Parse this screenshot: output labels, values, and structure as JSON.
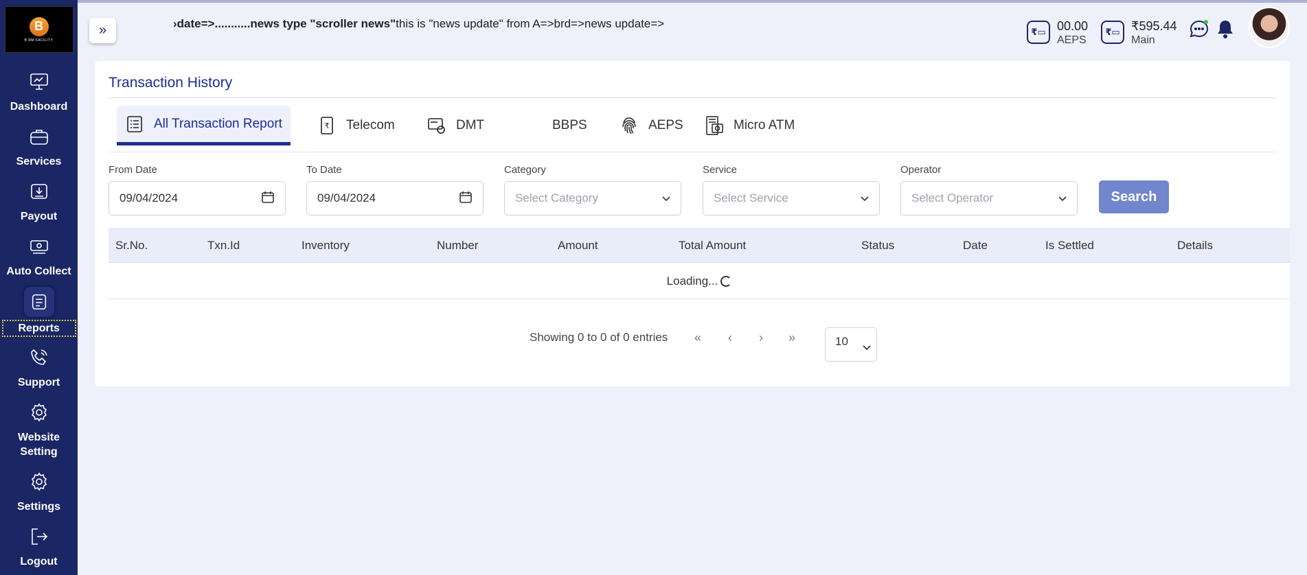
{
  "brand": {
    "logo_text": "B RM FACILITY"
  },
  "sidebar": {
    "items": [
      {
        "label": "Dashboard",
        "icon": "dashboard-icon"
      },
      {
        "label": "Services",
        "icon": "briefcase-icon"
      },
      {
        "label": "Payout",
        "icon": "payout-icon"
      },
      {
        "label": "Auto Collect",
        "icon": "card-icon"
      },
      {
        "label": "Reports",
        "icon": "report-icon"
      },
      {
        "label": "Support",
        "icon": "phone-icon"
      },
      {
        "label": "Website Setting",
        "icon": "gear-icon"
      },
      {
        "label": "Settings",
        "icon": "gear-icon"
      },
      {
        "label": "Logout",
        "icon": "logout-icon"
      }
    ]
  },
  "header": {
    "news_prefix": "›date=>...........news type \"scroller news\"",
    "news_rest": "this is \"news update\" from A=>brd=>news update=>",
    "wallets": [
      {
        "amount": "00.00",
        "label": "AEPS"
      },
      {
        "amount": "₹595.44",
        "label": "Main"
      }
    ]
  },
  "page": {
    "title": "Transaction History",
    "tabs": [
      {
        "label": "All Transaction Report"
      },
      {
        "label": "Telecom"
      },
      {
        "label": "DMT"
      },
      {
        "label": "BBPS"
      },
      {
        "label": "AEPS"
      },
      {
        "label": "Micro ATM"
      }
    ],
    "filters": {
      "from_label": "From Date",
      "from_value": "09/04/2024",
      "to_label": "To Date",
      "to_value": "09/04/2024",
      "category_label": "Category",
      "category_placeholder": "Select Category",
      "service_label": "Service",
      "service_placeholder": "Select Service",
      "operator_label": "Operator",
      "operator_placeholder": "Select Operator",
      "search_label": "Search"
    },
    "table": {
      "columns": [
        "Sr.No.",
        "Txn.Id",
        "Inventory",
        "Number",
        "Amount",
        "Total Amount",
        "Status",
        "Date",
        "Is Settled",
        "Details"
      ],
      "loading_text": "Loading..."
    },
    "pagination": {
      "summary": "Showing 0 to 0 of 0 entries",
      "first": "«",
      "prev": "‹",
      "next": "›",
      "last": "»",
      "page_size": "10"
    }
  }
}
